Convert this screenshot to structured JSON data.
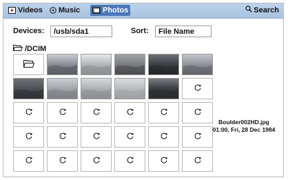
{
  "tabs": [
    {
      "label": "Videos",
      "icon": "video-icon",
      "active": false
    },
    {
      "label": "Music",
      "icon": "music-icon",
      "active": false
    },
    {
      "label": "Photos",
      "icon": "photos-icon",
      "active": true
    }
  ],
  "search": {
    "label": "Search",
    "icon": "search-icon"
  },
  "devices": {
    "label": "Devices:",
    "value": "/usb/sda1"
  },
  "sort": {
    "label": "Sort:",
    "value": "File Name"
  },
  "folder": {
    "icon": "open-folder-icon",
    "name": "/DCIM"
  },
  "grid": {
    "columns": 6,
    "cells": [
      {
        "type": "folder-up"
      },
      {
        "type": "thumb",
        "shade": "#8a8f96",
        "sky": "#c9cdd1",
        "ground": "#5a5e63"
      },
      {
        "type": "thumb",
        "shade": "#b3b6b9",
        "sky": "#e6e8ea",
        "ground": "#8b8f93"
      },
      {
        "type": "thumb",
        "shade": "#7a7c7f",
        "sky": "#a0a3a6",
        "ground": "#4b4d50"
      },
      {
        "type": "thumb",
        "shade": "#3c3f44",
        "sky": "#6d7177",
        "ground": "#26282b"
      },
      {
        "type": "thumb",
        "shade": "#8f949a",
        "sky": "#c2c6cb",
        "ground": "#62666b"
      },
      {
        "type": "thumb",
        "shade": "#4f5358",
        "sky": "#6f7378",
        "ground": "#2f3236"
      },
      {
        "type": "thumb",
        "shade": "#a2a6aa",
        "sky": "#c9ccd0",
        "ground": "#7d8186"
      },
      {
        "type": "thumb",
        "shade": "#aeb1b4",
        "sky": "#d6d8da",
        "ground": "#8c9094"
      },
      {
        "type": "thumb",
        "shade": "#b9bcbf",
        "sky": "#dadcde",
        "ground": "#9ea2a6"
      },
      {
        "type": "thumb",
        "shade": "#3a3d41",
        "sky": "#7a7e83",
        "ground": "#2a2c2f"
      },
      {
        "type": "loading"
      },
      {
        "type": "loading"
      },
      {
        "type": "loading"
      },
      {
        "type": "loading"
      },
      {
        "type": "loading"
      },
      {
        "type": "loading"
      },
      {
        "type": "loading"
      },
      {
        "type": "loading"
      },
      {
        "type": "loading"
      },
      {
        "type": "loading"
      },
      {
        "type": "loading"
      },
      {
        "type": "loading"
      },
      {
        "type": "loading"
      },
      {
        "type": "loading"
      },
      {
        "type": "loading"
      },
      {
        "type": "loading"
      },
      {
        "type": "loading"
      },
      {
        "type": "loading"
      },
      {
        "type": "loading"
      }
    ]
  },
  "selection": {
    "filename": "Boulder002HD.jpg",
    "datetime": "01:00, Fri, 28 Dec 1984"
  },
  "colors": {
    "topbar": "#b4cbe6",
    "active_tab": "#4a78b8"
  }
}
